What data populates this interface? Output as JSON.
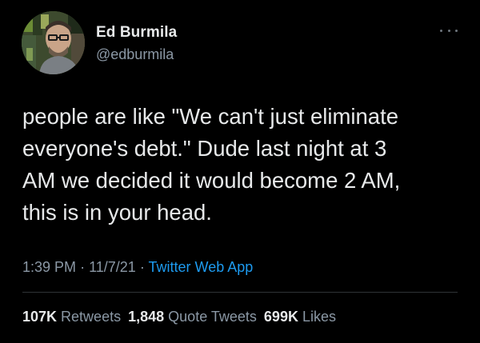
{
  "tweet": {
    "author": {
      "name": "Ed Burmila",
      "handle": "@edburmila",
      "avatar_icon": "profile-photo"
    },
    "more_icon": "more-dots-icon",
    "text": "people are like \"We can't just eliminate\neveryone's debt.\" Dude last night at 3\nAM we decided it would become 2 AM,\nthis is in your head.",
    "time": "1:39 PM",
    "separator": "·",
    "date": "11/7/21",
    "source": "Twitter Web App",
    "stats": {
      "retweets_count": "107K",
      "retweets_label": "Retweets",
      "quotes_count": "1,848",
      "quotes_label": "Quote Tweets",
      "likes_count": "699K",
      "likes_label": "Likes"
    }
  },
  "colors": {
    "background": "#000000",
    "text": "#e7e9ea",
    "secondary": "#8b98a5",
    "link": "#1d9bf0"
  }
}
